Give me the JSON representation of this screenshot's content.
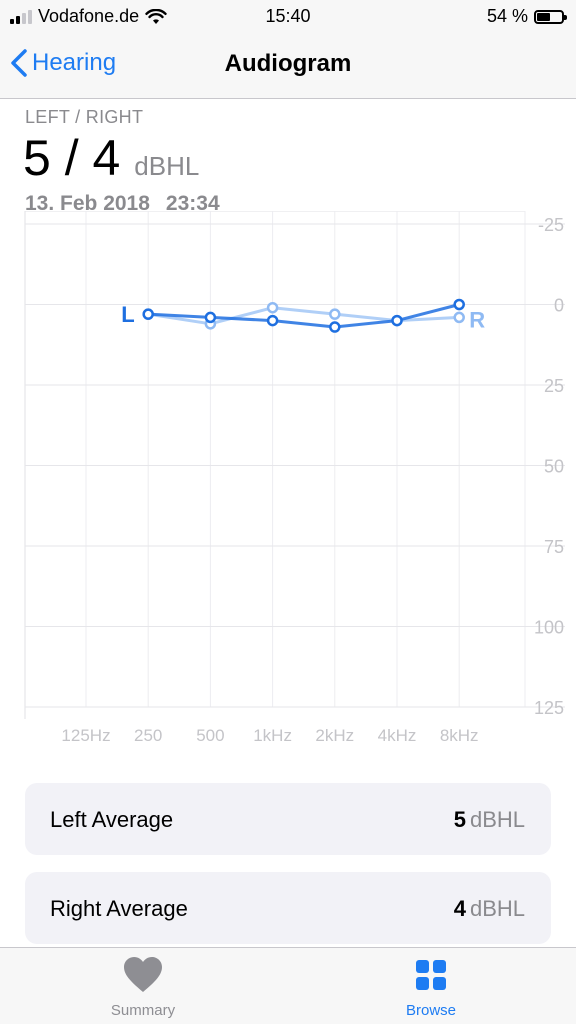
{
  "status_bar": {
    "carrier": "Vodafone.de",
    "time": "15:40",
    "battery": "54 %",
    "battery_level": 0.54
  },
  "nav": {
    "back_label": "Hearing",
    "title": "Audiogram"
  },
  "summary": {
    "range_label": "LEFT / RIGHT",
    "value": "5 / 4",
    "unit": "dBHL",
    "date": "13. Feb 2018",
    "time": "23:34"
  },
  "chart_data": {
    "type": "line",
    "x_labels": [
      "125Hz",
      "250",
      "500",
      "1kHz",
      "2kHz",
      "4kHz",
      "8kHz"
    ],
    "y_ticks": [
      "-25",
      "0",
      "25",
      "50",
      "75",
      "100",
      "125"
    ],
    "ylim": [
      -25,
      125
    ],
    "y_inverted": true,
    "grid": true,
    "series": [
      {
        "name": "L",
        "color": "#1e6fe0",
        "x": [
          "250",
          "500",
          "1kHz",
          "2kHz",
          "4kHz",
          "8kHz"
        ],
        "values": [
          3,
          4,
          5,
          7,
          5,
          0
        ]
      },
      {
        "name": "R",
        "color": "#8fbaf3",
        "x": [
          "250",
          "500",
          "1kHz",
          "2kHz",
          "4kHz",
          "8kHz"
        ],
        "values": [
          3,
          6,
          1,
          3,
          5,
          4
        ]
      }
    ]
  },
  "averages": {
    "left": {
      "label": "Left Average",
      "value": "5",
      "unit": "dBHL"
    },
    "right": {
      "label": "Right Average",
      "value": "4",
      "unit": "dBHL"
    }
  },
  "tabs": [
    {
      "label": "Summary",
      "icon": "heart-icon",
      "color": "#8e8e93"
    },
    {
      "label": "Browse",
      "icon": "grid-icon",
      "color": "#1e7cf2"
    }
  ]
}
